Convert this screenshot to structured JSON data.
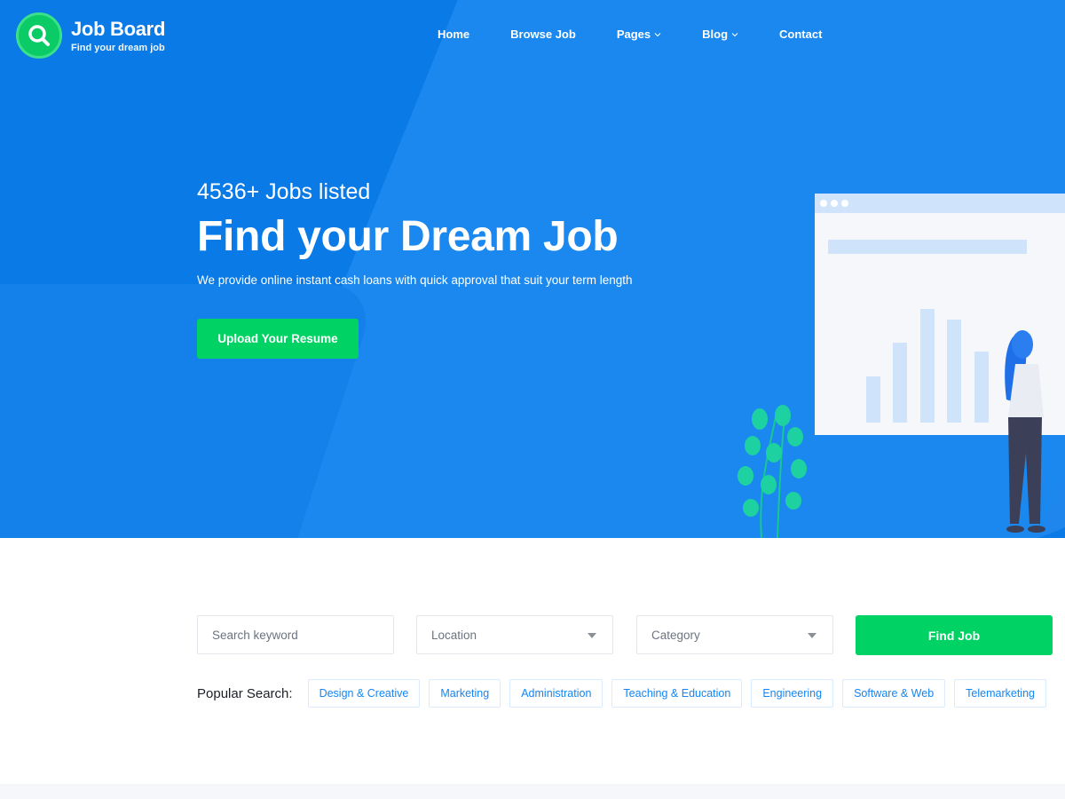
{
  "brand": {
    "title": "Job Board",
    "tagline": "Find your dream job"
  },
  "nav": [
    {
      "label": "Home",
      "dropdown": false
    },
    {
      "label": "Browse Job",
      "dropdown": false
    },
    {
      "label": "Pages",
      "dropdown": true
    },
    {
      "label": "Blog",
      "dropdown": true
    },
    {
      "label": "Contact",
      "dropdown": false
    }
  ],
  "hero": {
    "count": "4536+ Jobs listed",
    "title": "Find your Dream Job",
    "subtitle": "We provide online instant cash loans with quick approval that suit your term length",
    "cta": "Upload Your Resume"
  },
  "search": {
    "keyword_placeholder": "Search keyword",
    "location_value": "Location",
    "category_value": "Category",
    "button": "Find Job"
  },
  "popular": {
    "label": "Popular Search:",
    "tags": [
      "Design & Creative",
      "Marketing",
      "Administration",
      "Teaching & Education",
      "Engineering",
      "Software & Web",
      "Telemarketing"
    ]
  },
  "colors": {
    "primary_blue": "#0a7ae6",
    "accent_green": "#00d363",
    "tag_text": "#1585f3"
  }
}
